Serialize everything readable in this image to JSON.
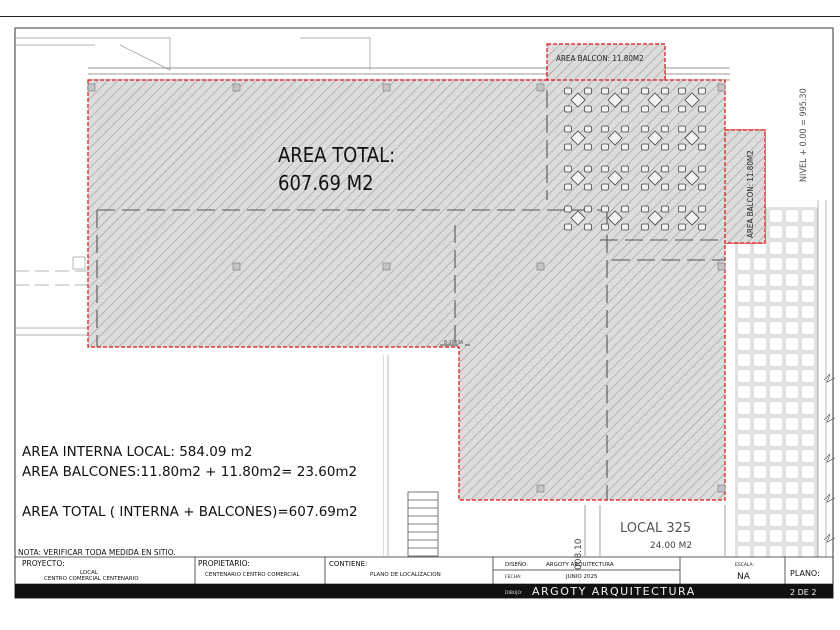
{
  "plan": {
    "area_total_label": "AREA TOTAL:",
    "area_total_value": "607.69 M2",
    "balcony_top_label": "AREA BALCON: 11.80M2",
    "balcony_right_label": "AREA BALCON: 11.80M2",
    "level_label": "NIVEL + 0.00 = 995.30",
    "small_tag": "008.10",
    "local_325_name": "LOCAL  325",
    "local_325_area": "24.00 M2",
    "column_tag": "B-1003A",
    "summary_internal": "AREA INTERNA LOCAL: 584.09 m2",
    "summary_balconies": "AREA BALCONES:11.80m2 + 11.80m2= 23.60m2",
    "summary_total": "AREA TOTAL ( INTERNA + BALCONES)=607.69m2",
    "note": "NOTA: VERIFICAR TODA MEDIDA EN SITIO."
  },
  "title_block": {
    "proyecto_label": "PROYECTO:",
    "proyecto_value_1": "LOCAL",
    "proyecto_value_2": "CENTRO COMERCIAL CENTENARIO",
    "propietario_label": "PROPIETARIO:",
    "propietario_value": "CENTENARIO CENTRO COMERCIAL",
    "contiene_label": "CONTIENE:",
    "contiene_value": "PLANO DE LOCALIZACION",
    "diseno_label": "DISEÑO:",
    "diseno_value": "ARGOTY ARQUITECTURA",
    "fecha_label": "FECHA:",
    "fecha_value": "JUNIO 2025",
    "escala_label": "ESCALA:",
    "escala_value": "NA",
    "plano_label": "PLANO:",
    "dibujo_label": "DIBUJO:",
    "firm_name": "ARGOTY ARQUITECTURA",
    "sheet_number": "2 DE 2"
  },
  "colors": {
    "boundary": "#e01010",
    "hatch": "#8a8a8a",
    "fill": "#d9d9d9",
    "line": "#333333",
    "title_bar": "#111111"
  }
}
